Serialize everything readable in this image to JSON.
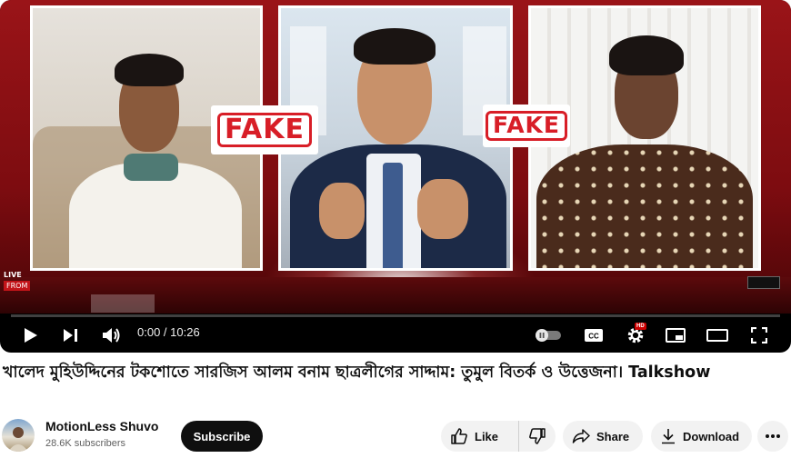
{
  "video": {
    "current_time": "0:00",
    "duration": "10:26",
    "time_display": "0:00 / 10:26",
    "progress_fraction": 0.0,
    "overlay": {
      "stamp_text": "FAKE",
      "live_label": "LIVE",
      "from_label": "FROM"
    },
    "settings_badge": "HD"
  },
  "title": "খালেদ মুহিউদ্দিনের টকশোতে সারজিস আলম বনাম ছাত্রলীগের সাদ্দাম: তুমুল বিতর্ক ও উত্তেজনা। Talkshow",
  "channel": {
    "name": "MotionLess Shuvo",
    "subscribers": "28.6K subscribers",
    "subscribe_label": "Subscribe"
  },
  "actions": {
    "like_label": "Like",
    "share_label": "Share",
    "download_label": "Download"
  },
  "colors": {
    "accent": "#ff0000",
    "stamp": "#d81e27",
    "background": "#ffffff",
    "pill": "#f2f2f2"
  }
}
